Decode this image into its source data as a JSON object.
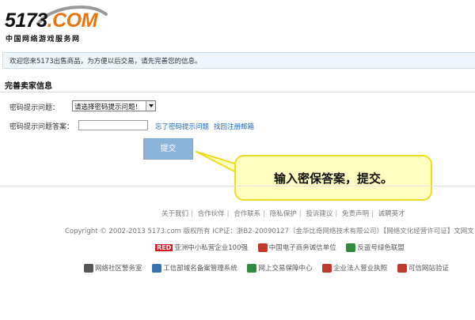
{
  "logo": {
    "brand": "5173",
    "brand_suffix": ".COM",
    "subtitle": "中国网络游戏服务网"
  },
  "notice": {
    "text": "欢迎您来5173出售商品，为方便以后交易，请先完善您的信息。"
  },
  "form": {
    "title": "完善卖家信息",
    "question_label": "密码提示问题：",
    "question_selected": "请选择密码提示问题！",
    "answer_label": "密码提示问题答案：",
    "answer_value": "",
    "forgot_link": "忘了密码提示问题",
    "recover_link": "找回注册邮箱",
    "submit_label": "提交"
  },
  "callout": {
    "text": "输入密保答案，提交。"
  },
  "footer": {
    "links": [
      "关于我们",
      "合作伙伴",
      "合作联系",
      "隐私保护",
      "投诉建议",
      "免责声明",
      "诚聘英才"
    ],
    "copyright": "Copyright © 2002-2013 5173.com 版权所有   ICP证：浙B2-20090127（金华比奇网络技术有限公司）【网络文化经营许可证】文网文",
    "badges_row1": [
      {
        "tag": "RED",
        "label": "亚洲中小私营企业100强",
        "icon": "red-tag-icon"
      },
      {
        "label": "中国电子商务诚信单位",
        "icon": "ecommerce-trust-icon",
        "color": "#c0392b"
      },
      {
        "label": "反盗号绿色联盟",
        "icon": "green-alliance-icon",
        "color": "#2e8b3e"
      }
    ],
    "badges_row2": [
      {
        "label": "网络社区警务室",
        "icon": "police-icon",
        "color": "#555555"
      },
      {
        "label": "工信部域名备案管理系统",
        "icon": "miit-icon",
        "color": "#3a6fb0"
      },
      {
        "label": "网上交易保障中心",
        "icon": "trade-guarantee-icon",
        "color": "#2e8b3e"
      },
      {
        "label": "企业法人营业执照",
        "icon": "license-icon",
        "color": "#c0392b"
      },
      {
        "label": "可信网站验证",
        "icon": "trusted-site-icon",
        "color": "#c0392b"
      }
    ]
  }
}
